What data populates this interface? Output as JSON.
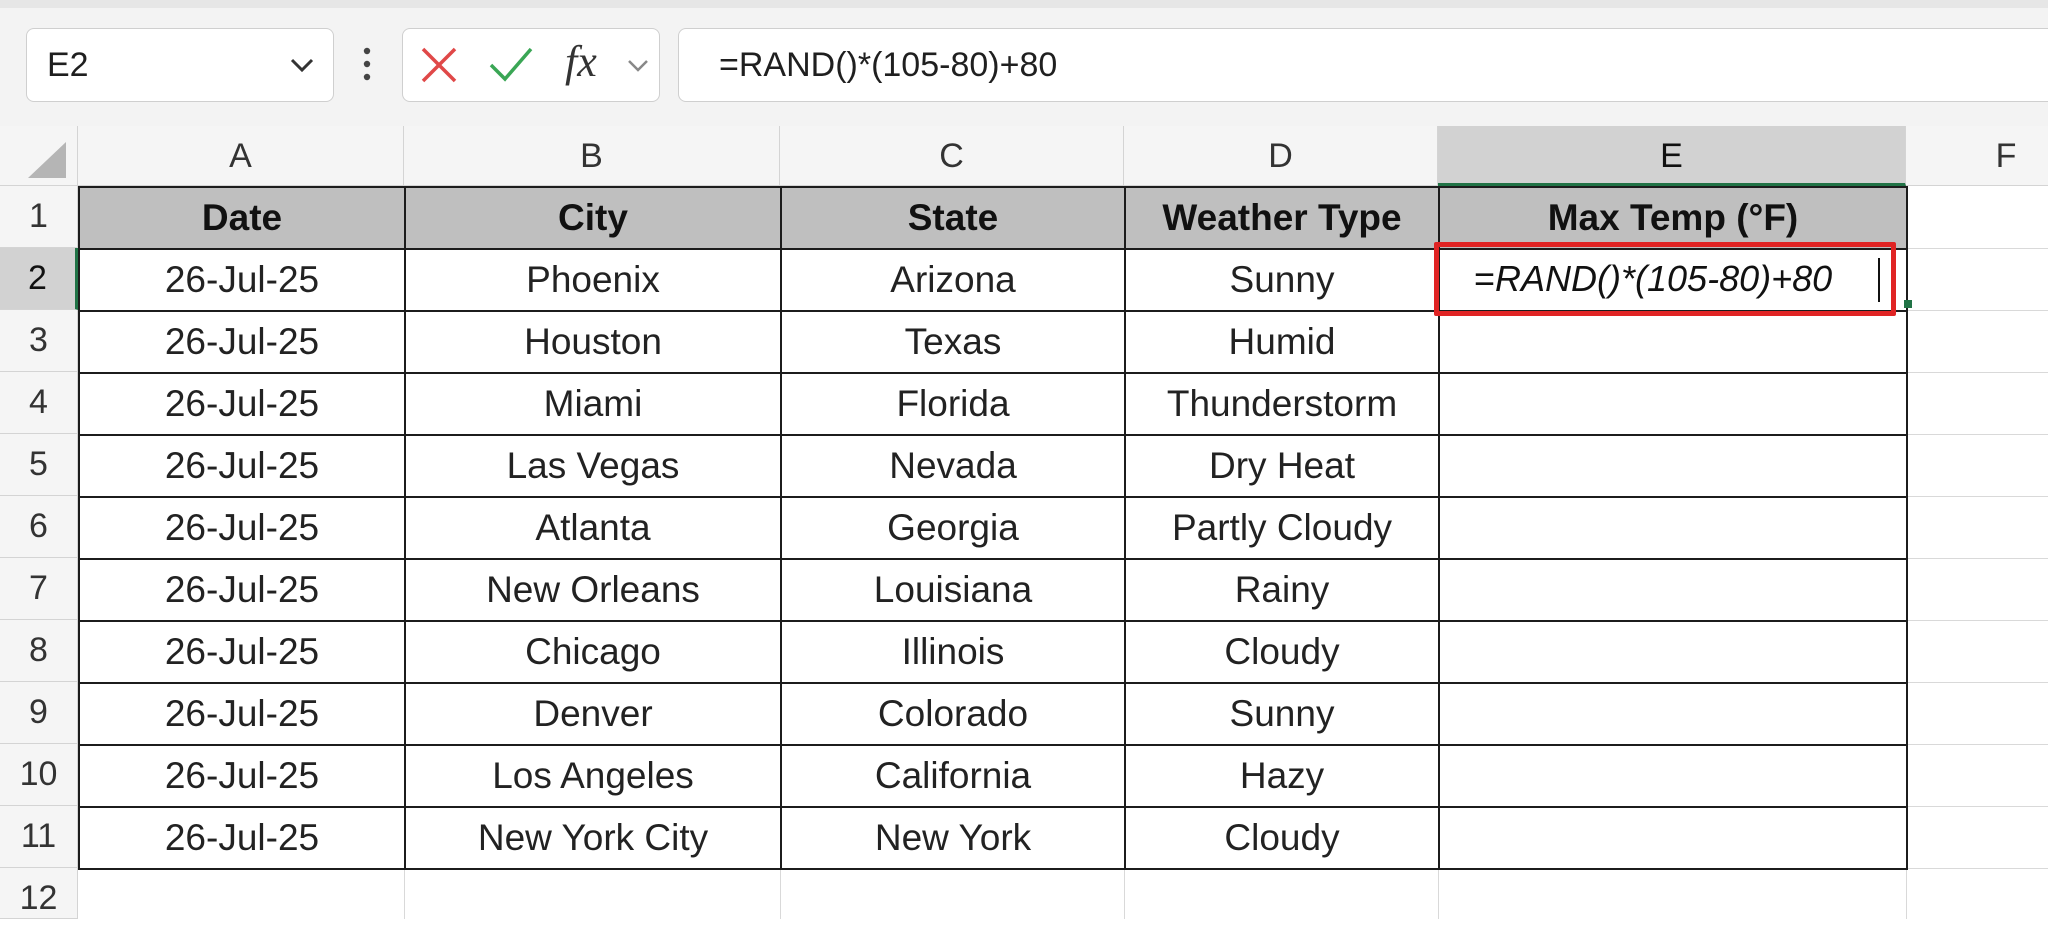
{
  "formula_bar": {
    "name_box": "E2",
    "cancel_icon": "close-icon",
    "enter_icon": "check-icon",
    "fx_label": "fx",
    "formula": "=RAND()*(105-80)+80"
  },
  "columns": [
    "A",
    "B",
    "C",
    "D",
    "E",
    "F"
  ],
  "selected_column": "E",
  "rows": [
    "1",
    "2",
    "3",
    "4",
    "5",
    "6",
    "7",
    "8",
    "9",
    "10",
    "11",
    "12"
  ],
  "selected_row": "2",
  "table": {
    "headers": [
      "Date",
      "City",
      "State",
      "Weather Type",
      "Max Temp (°F)"
    ],
    "rows": [
      [
        "26-Jul-25",
        "Phoenix",
        "Arizona",
        "Sunny",
        ""
      ],
      [
        "26-Jul-25",
        "Houston",
        "Texas",
        "Humid",
        ""
      ],
      [
        "26-Jul-25",
        "Miami",
        "Florida",
        "Thunderstorm",
        ""
      ],
      [
        "26-Jul-25",
        "Las Vegas",
        "Nevada",
        "Dry Heat",
        ""
      ],
      [
        "26-Jul-25",
        "Atlanta",
        "Georgia",
        "Partly Cloudy",
        ""
      ],
      [
        "26-Jul-25",
        "New Orleans",
        "Louisiana",
        "Rainy",
        ""
      ],
      [
        "26-Jul-25",
        "Chicago",
        "Illinois",
        "Cloudy",
        ""
      ],
      [
        "26-Jul-25",
        "Denver",
        "Colorado",
        "Sunny",
        ""
      ],
      [
        "26-Jul-25",
        "Los Angeles",
        "California",
        "Hazy",
        ""
      ],
      [
        "26-Jul-25",
        "New York City",
        "New York",
        "Cloudy",
        ""
      ]
    ]
  },
  "editing_cell": {
    "ref": "E2",
    "prefix": "=",
    "text": "RAND()*(105-80)+80"
  },
  "colors": {
    "header_fill": "#bfbfbf",
    "selection_green": "#217346",
    "highlight_red": "#e02424"
  }
}
